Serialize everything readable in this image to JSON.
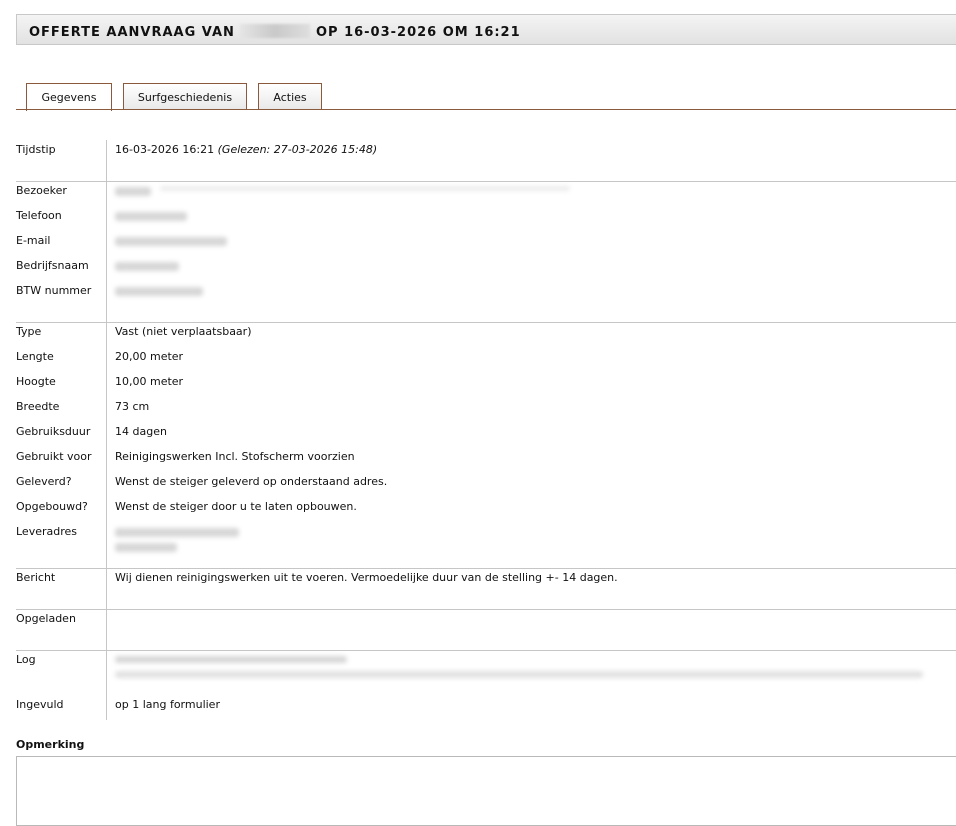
{
  "header": {
    "title_prefix": "OFFERTE AANVRAAG VAN",
    "title_suffix": "OP 16-03-2026 OM 16:21"
  },
  "tabs": [
    {
      "label": "Gegevens",
      "active": true
    },
    {
      "label": "Surfgeschiedenis",
      "active": false
    },
    {
      "label": "Acties",
      "active": false
    }
  ],
  "fields": {
    "tijdstip": {
      "label": "Tijdstip",
      "value": "16-03-2026 16:21",
      "read_note": "(Gelezen: 27-03-2026 15:48)"
    },
    "bezoeker": {
      "label": "Bezoeker"
    },
    "telefoon": {
      "label": "Telefoon"
    },
    "email": {
      "label": "E-mail"
    },
    "bedrijfsnaam": {
      "label": "Bedrijfsnaam"
    },
    "btw": {
      "label": "BTW nummer"
    },
    "type": {
      "label": "Type",
      "value": "Vast (niet verplaatsbaar)"
    },
    "lengte": {
      "label": "Lengte",
      "value": "20,00 meter"
    },
    "hoogte": {
      "label": "Hoogte",
      "value": "10,00 meter"
    },
    "breedte": {
      "label": "Breedte",
      "value": "73 cm"
    },
    "gebruiksduur": {
      "label": "Gebruiksduur",
      "value": "14 dagen"
    },
    "gebruikt_voor": {
      "label": "Gebruikt voor",
      "value": "Reinigingswerken Incl. Stofscherm voorzien"
    },
    "geleverd": {
      "label": "Geleverd?",
      "value": "Wenst de steiger geleverd op onderstaand adres."
    },
    "opgebouwd": {
      "label": "Opgebouwd?",
      "value": "Wenst de steiger door u te laten opbouwen."
    },
    "leveradres": {
      "label": "Leveradres"
    },
    "bericht": {
      "label": "Bericht",
      "value": "Wij dienen reinigingswerken uit te voeren. Vermoedelijke duur van de stelling +- 14 dagen."
    },
    "opgeladen": {
      "label": "Opgeladen"
    },
    "log": {
      "label": "Log"
    },
    "ingevuld": {
      "label": "Ingevuld",
      "value": "op 1 lang formulier"
    }
  },
  "opmerking": {
    "label": "Opmerking",
    "value": ""
  },
  "colors": {
    "accent": "#8b5a3c",
    "separator": "#c6c6c6"
  }
}
